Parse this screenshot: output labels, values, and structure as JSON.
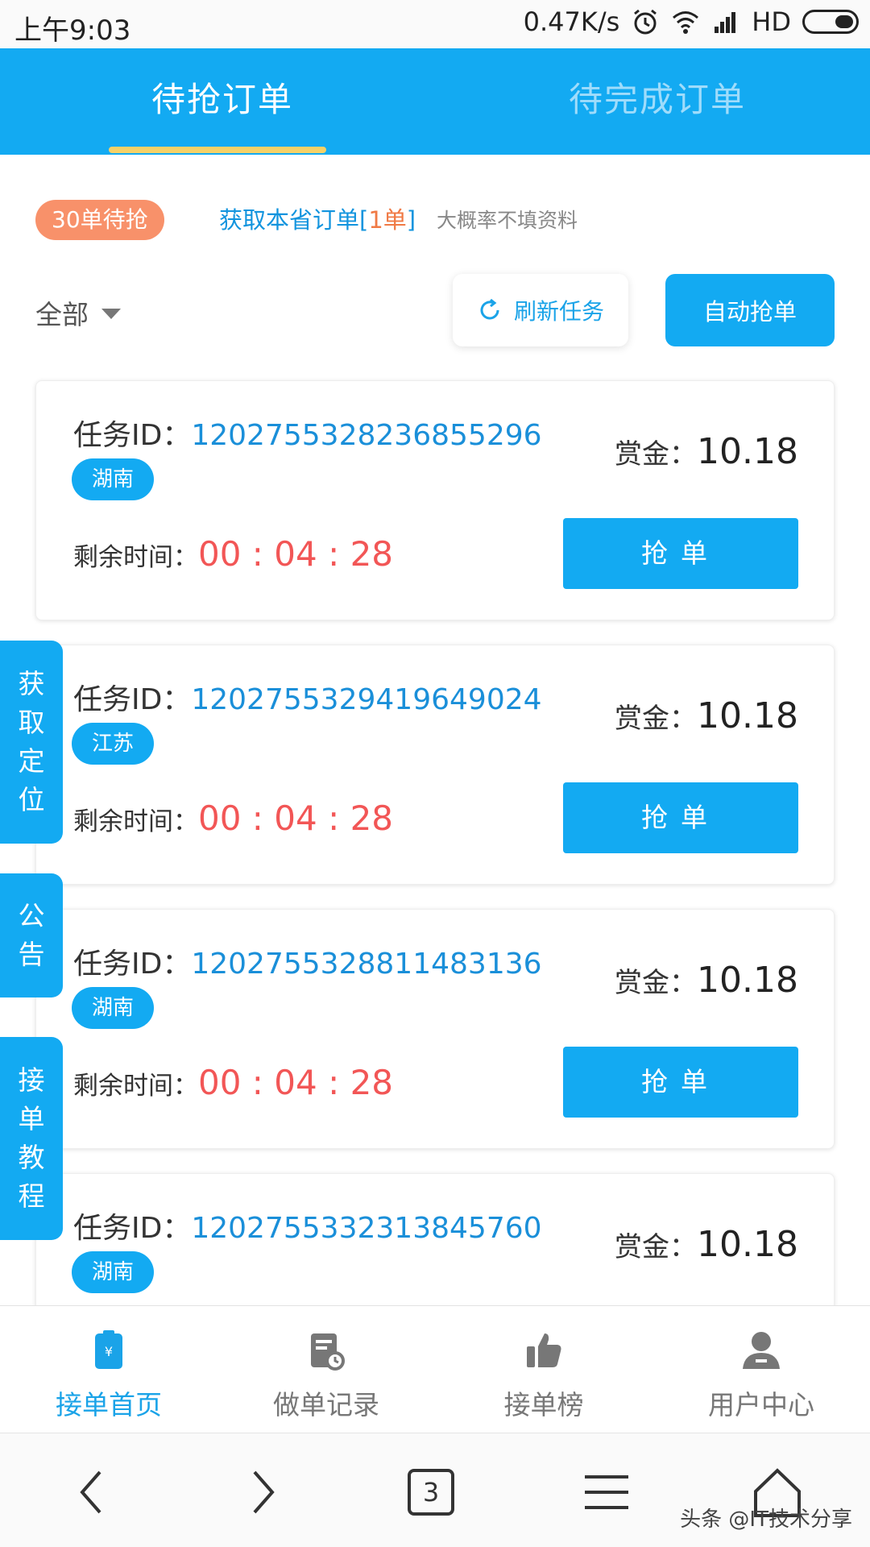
{
  "status_bar": {
    "time": "上午9:03",
    "speed": "0.47K/s",
    "network": "HD"
  },
  "tabs": [
    {
      "label": "待抢订单",
      "active": true
    },
    {
      "label": "待完成订单",
      "active": false
    }
  ],
  "toolbar": {
    "pending_badge": "30单待抢",
    "province_link_prefix": "获取本省订单[",
    "province_link_count": "1单",
    "province_link_suffix": "]",
    "province_hint": "大概率不填资料",
    "filter_label": "全部",
    "refresh_label": "刷新任务",
    "auto_label": "自动抢单"
  },
  "cards": [
    {
      "id_label": "任务ID：",
      "id": "1202755328236855296",
      "region": "湖南",
      "reward_label": "赏金：",
      "reward": "10.18",
      "remain_label": "剩余时间：",
      "remain": "00 : 04 : 28",
      "button": "抢单"
    },
    {
      "id_label": "任务ID：",
      "id": "1202755329419649024",
      "region": "江苏",
      "reward_label": "赏金：",
      "reward": "10.18",
      "remain_label": "剩余时间：",
      "remain": "00 : 04 : 28",
      "button": "抢单"
    },
    {
      "id_label": "任务ID：",
      "id": "1202755328811483136",
      "region": "湖南",
      "reward_label": "赏金：",
      "reward": "10.18",
      "remain_label": "剩余时间：",
      "remain": "00 : 04 : 28",
      "button": "抢单"
    },
    {
      "id_label": "任务ID：",
      "id": "1202755332313845760",
      "region": "湖南",
      "reward_label": "赏金：",
      "reward": "10.18"
    }
  ],
  "side_tabs": [
    {
      "chars": [
        "获",
        "取",
        "定",
        "位"
      ]
    },
    {
      "chars": [
        "公",
        "告"
      ]
    },
    {
      "chars": [
        "接",
        "单",
        "教",
        "程"
      ]
    }
  ],
  "bottom_nav": [
    {
      "label": "接单首页",
      "icon": "order-home-icon",
      "active": true
    },
    {
      "label": "做单记录",
      "icon": "record-icon",
      "active": false
    },
    {
      "label": "接单榜",
      "icon": "thumbs-up-icon",
      "active": false
    },
    {
      "label": "用户中心",
      "icon": "user-icon",
      "active": false
    }
  ],
  "system_nav": {
    "tab_count": "3",
    "watermark": "头条 @IT技术分享"
  },
  "colors": {
    "primary": "#13aaf2",
    "accent_orange": "#f8916a",
    "timer_red": "#f25656",
    "tab_underline": "#f6d168"
  }
}
